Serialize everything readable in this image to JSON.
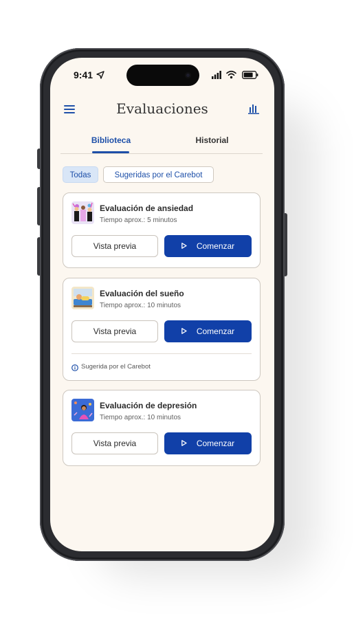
{
  "status_bar": {
    "time": "9:41"
  },
  "header": {
    "title": "Evaluaciones"
  },
  "tabs": [
    {
      "label": "Biblioteca",
      "active": true
    },
    {
      "label": "Historial",
      "active": false
    }
  ],
  "filters": [
    {
      "label": "Todas",
      "selected": true
    },
    {
      "label": "Sugeridas por el Carebot",
      "selected": false
    }
  ],
  "cards": [
    {
      "title": "Evaluación de ansiedad",
      "subtitle": "Tiempo aprox.: 5 minutos",
      "preview_label": "Vista previa",
      "start_label": "Comenzar"
    },
    {
      "title": "Evaluación del sueño",
      "subtitle": "Tiempo aprox.: 10 minutos",
      "preview_label": "Vista previa",
      "start_label": "Comenzar",
      "note": "Sugerida por el Carebot"
    },
    {
      "title": "Evaluación de depresión",
      "subtitle": "Tiempo aprox.: 10 minutos",
      "preview_label": "Vista previa",
      "start_label": "Comenzar"
    }
  ],
  "colors": {
    "accent": "#1140a8",
    "background": "#fcf7f0",
    "chip_selected": "#d9e6f7"
  },
  "icons": [
    "location-arrow-icon",
    "signal-icon",
    "wifi-icon",
    "battery-icon",
    "menu-icon",
    "bar-chart-icon",
    "play-icon",
    "info-icon"
  ]
}
